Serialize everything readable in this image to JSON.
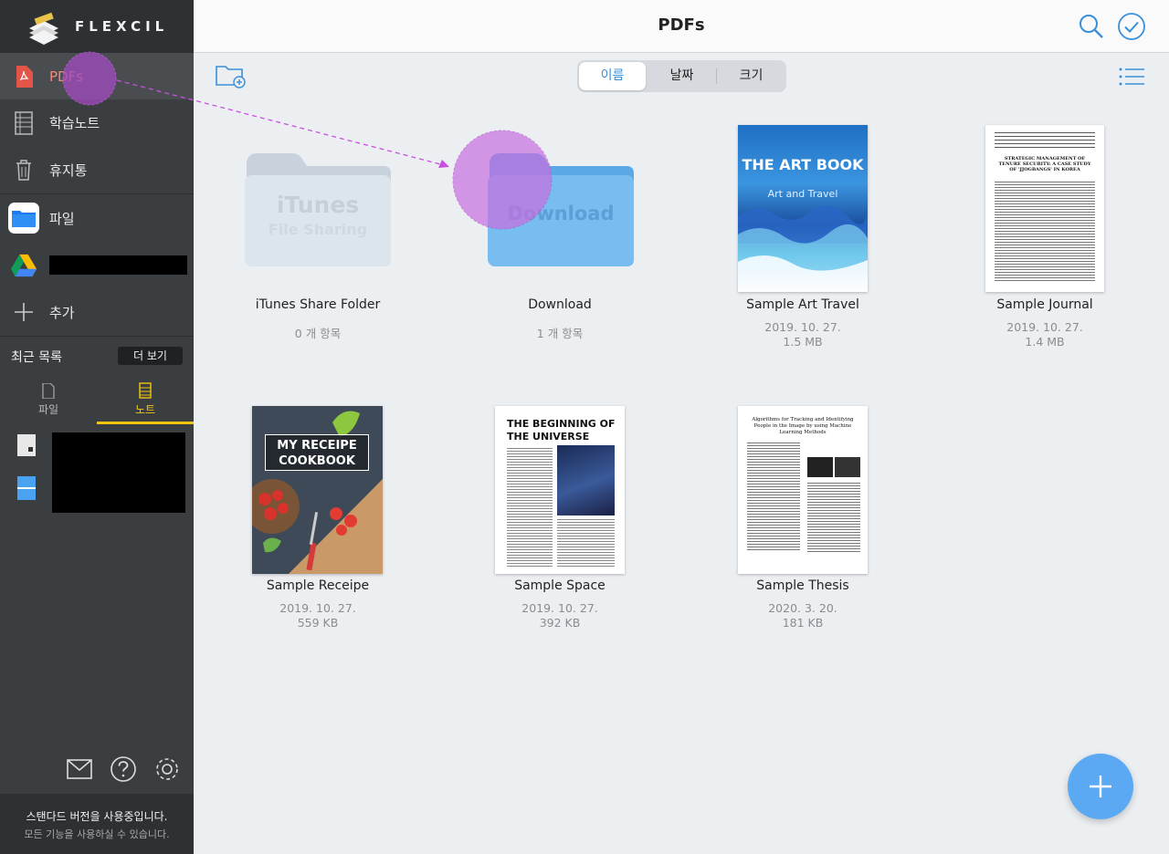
{
  "app": {
    "logo_text": "FLEXCIL"
  },
  "sidebar": {
    "items": [
      {
        "label": "PDFs"
      },
      {
        "label": "학습노트"
      },
      {
        "label": "휴지통"
      },
      {
        "label": "파일"
      },
      {
        "label": ""
      },
      {
        "label": "추가"
      }
    ],
    "recent": {
      "title": "최근 목록",
      "more_label": "더 보기"
    },
    "subtabs": [
      {
        "label": "파일"
      },
      {
        "label": "노트"
      }
    ],
    "footer": {
      "line1": "스탠다드 버전을 사용중입니다.",
      "line2": "모든 기능을 사용하실 수 있습니다."
    }
  },
  "header": {
    "title": "PDFs"
  },
  "sort": {
    "options": [
      "이름",
      "날짜",
      "크기"
    ],
    "selected": "이름"
  },
  "items": [
    {
      "name": "iTunes Share Folder",
      "line1": "0 개 항목",
      "line2": "",
      "folder_title": "iTunes",
      "folder_sub": "File Sharing"
    },
    {
      "name": "Download",
      "line1": "1 개 항목",
      "line2": "",
      "folder_title": "Download"
    },
    {
      "name": "Sample Art Travel",
      "line1": "2019. 10. 27.",
      "line2": "1.5 MB",
      "cover_title": "THE ART BOOK",
      "cover_sub": "Art and Travel"
    },
    {
      "name": "Sample Journal",
      "line1": "2019. 10. 27.",
      "line2": "1.4 MB",
      "cover_title": "STRATEGIC MANAGEMENT OF TENURE SECURITY: A CASE STUDY OF 'JJOGBANGS' IN KOREA"
    },
    {
      "name": "Sample Receipe",
      "line1": "2019. 10. 27.",
      "line2": "559 KB",
      "cover_title": "MY RECEIPE COOKBOOK"
    },
    {
      "name": "Sample Space",
      "line1": "2019. 10. 27.",
      "line2": "392 KB",
      "cover_title": "THE BEGINNING OF THE UNIVERSE"
    },
    {
      "name": "Sample Thesis",
      "line1": "2020. 3. 20.",
      "line2": "181 KB",
      "cover_title": "Algorithms for Tracking and Identifying People in the Image by using Machine Learning Methods"
    }
  ],
  "colors": {
    "accent": "#3a8fd9",
    "sidebar_bg": "#3b3e40",
    "fab": "#5aa9f2",
    "drag_highlight": "#c86ee0"
  }
}
